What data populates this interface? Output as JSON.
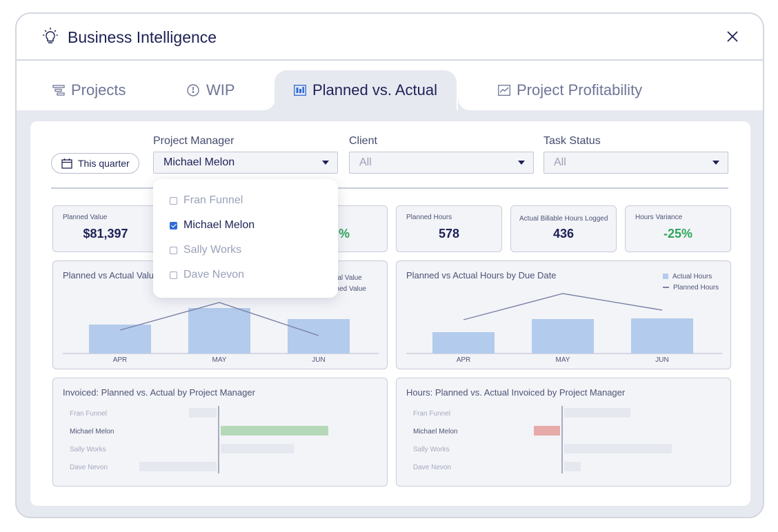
{
  "app": {
    "title": "Business Intelligence"
  },
  "tabs": [
    {
      "label": "Projects"
    },
    {
      "label": "WIP"
    },
    {
      "label": "Planned vs. Actual"
    },
    {
      "label": "Project Profitability"
    }
  ],
  "filters": {
    "period": "This quarter",
    "project_manager": {
      "label": "Project Manager",
      "value": "Michael Melon",
      "options": [
        {
          "label": "Fran Funnel",
          "checked": false
        },
        {
          "label": "Michael Melon",
          "checked": true
        },
        {
          "label": "Sally Works",
          "checked": false
        },
        {
          "label": "Dave Nevon",
          "checked": false
        }
      ]
    },
    "client": {
      "label": "Client",
      "value": "All"
    },
    "task_status": {
      "label": "Task Status",
      "value": "All"
    }
  },
  "kpis": [
    {
      "label": "Planned Value",
      "value": "$81,397"
    },
    {
      "label": "",
      "value": "%"
    },
    {
      "label": "Planned Hours",
      "value": "578"
    },
    {
      "label": "Actual Billable Hours Logged",
      "value": "436"
    },
    {
      "label": "Hours Variance",
      "value": "-25%"
    }
  ],
  "colors": {
    "bar": "#b3cbec",
    "line": "#7a80a6",
    "positive": "#b5d9b8",
    "negative": "#e6aaa8",
    "neutral": "#e6e8ef",
    "accent": "#2f6bd6"
  },
  "chart_data": [
    {
      "type": "bar",
      "title": "Planned vs Actual Valu",
      "categories": [
        "APR",
        "MAY",
        "JUN"
      ],
      "series": [
        {
          "name": "tual Value",
          "kind": "bar",
          "values": [
            42,
            66,
            50
          ]
        },
        {
          "name": "nned Value",
          "kind": "line",
          "values": [
            34,
            74,
            26
          ]
        }
      ],
      "ylim": [
        0,
        100
      ]
    },
    {
      "type": "bar",
      "title": "Planned vs Actual Hours by Due Date",
      "categories": [
        "APR",
        "MAY",
        "JUN"
      ],
      "series": [
        {
          "name": "Actual Hours",
          "kind": "bar",
          "values": [
            31,
            50,
            51
          ]
        },
        {
          "name": "Planned Hours",
          "kind": "line",
          "values": [
            49,
            87,
            63
          ]
        }
      ],
      "ylim": [
        0,
        100
      ]
    },
    {
      "type": "bar",
      "orientation": "horizontal",
      "title": "Invoiced: Planned vs. Actual by Project Manager",
      "categories": [
        "Fran Funnel",
        "Michael Melon",
        "Sally Works",
        "Dave Nevon"
      ],
      "values": [
        -40,
        156,
        106,
        -112
      ],
      "highlight": "Michael Melon",
      "xlim": [
        -120,
        160
      ]
    },
    {
      "type": "bar",
      "orientation": "horizontal",
      "title": "Hours: Planned vs. Actual Invoiced by Project Manager",
      "categories": [
        "Fran Funnel",
        "Michael Melon",
        "Sally Works",
        "Dave Nevon"
      ],
      "values": [
        96,
        -38,
        156,
        24
      ],
      "highlight": "Michael Melon",
      "xlim": [
        -50,
        160
      ]
    }
  ]
}
